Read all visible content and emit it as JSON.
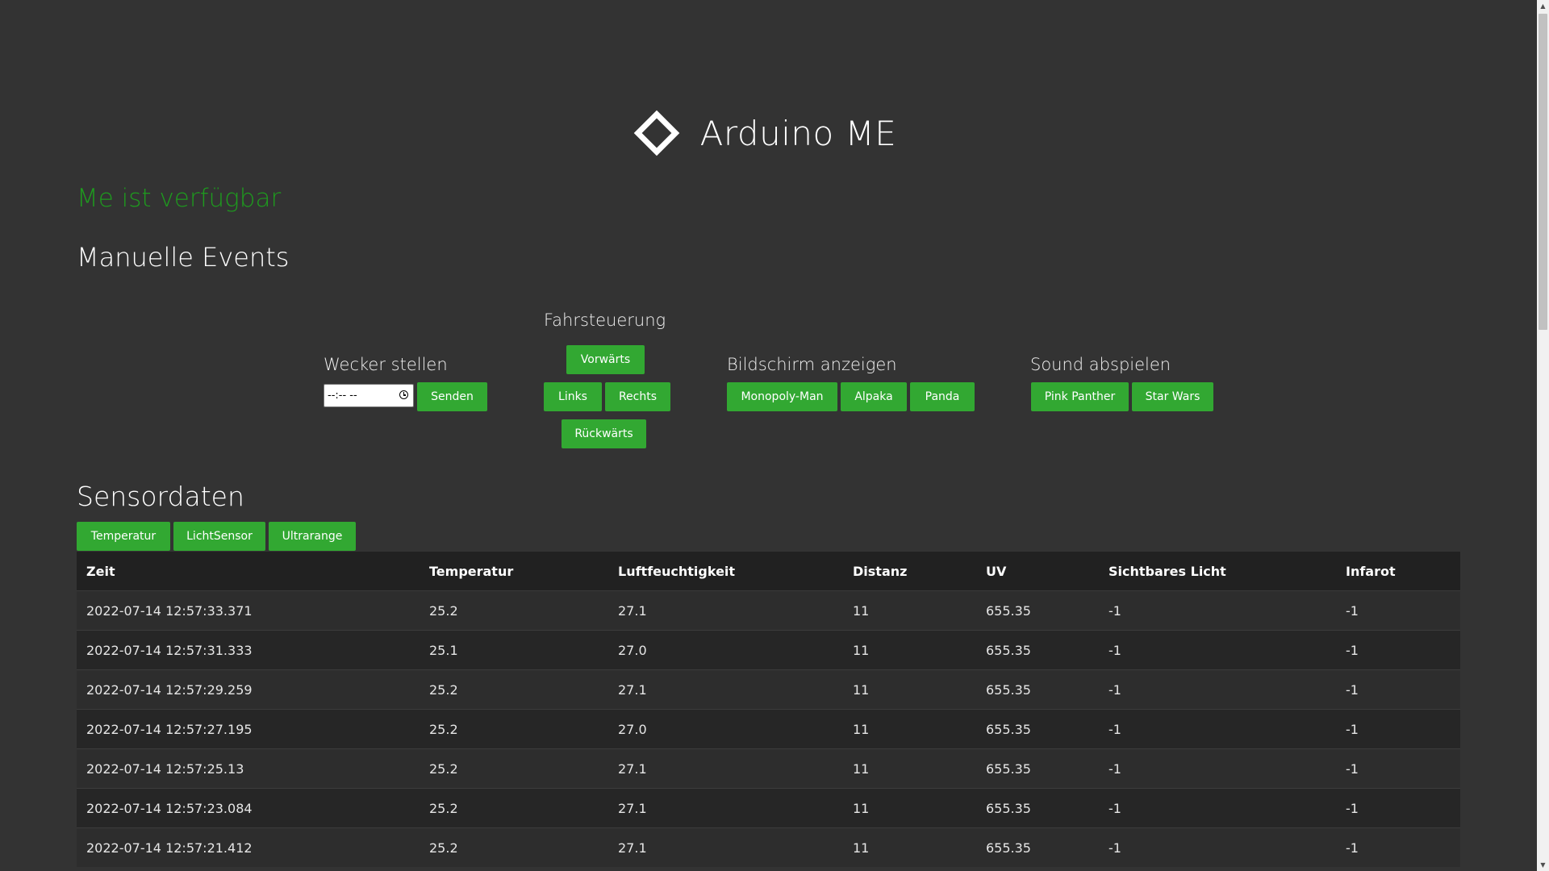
{
  "header": {
    "title": "Arduino ME",
    "logo_icon": "diamond-outline-icon"
  },
  "status": {
    "text": "Me ist verfügbar",
    "color": "#1e9b1e"
  },
  "manual": {
    "title": "Manuelle Events",
    "alarm": {
      "title": "Wecker stellen",
      "time_value": "--:-- --",
      "send_label": "Senden"
    },
    "drive": {
      "title": "Fahrsteuerung",
      "forward": "Vorwärts",
      "left": "Links",
      "right": "Rechts",
      "backward": "Rückwärts"
    },
    "screen": {
      "title": "Bildschirm anzeigen",
      "buttons": [
        "Monopoly-Man",
        "Alpaka",
        "Panda"
      ]
    },
    "sound": {
      "title": "Sound abspielen",
      "buttons": [
        "Pink Panther",
        "Star Wars"
      ]
    }
  },
  "sensors": {
    "title": "Sensordaten",
    "filter_buttons": [
      "Temperatur",
      "LichtSensor",
      "Ultrarange"
    ],
    "columns": [
      "Zeit",
      "Temperatur",
      "Luftfeuchtigkeit",
      "Distanz",
      "UV",
      "Sichtbares Licht",
      "Infarot"
    ],
    "rows": [
      [
        "2022-07-14 12:57:33.371",
        "25.2",
        "27.1",
        "11",
        "655.35",
        "-1",
        "-1"
      ],
      [
        "2022-07-14 12:57:31.333",
        "25.1",
        "27.0",
        "11",
        "655.35",
        "-1",
        "-1"
      ],
      [
        "2022-07-14 12:57:29.259",
        "25.2",
        "27.1",
        "11",
        "655.35",
        "-1",
        "-1"
      ],
      [
        "2022-07-14 12:57:27.195",
        "25.2",
        "27.0",
        "11",
        "655.35",
        "-1",
        "-1"
      ],
      [
        "2022-07-14 12:57:25.13",
        "25.2",
        "27.1",
        "11",
        "655.35",
        "-1",
        "-1"
      ],
      [
        "2022-07-14 12:57:23.084",
        "25.2",
        "27.1",
        "11",
        "655.35",
        "-1",
        "-1"
      ],
      [
        "2022-07-14 12:57:21.412",
        "25.2",
        "27.1",
        "11",
        "655.35",
        "-1",
        "-1"
      ]
    ]
  },
  "colors": {
    "background": "#333333",
    "button": "#32a832",
    "table_header": "#212121"
  }
}
